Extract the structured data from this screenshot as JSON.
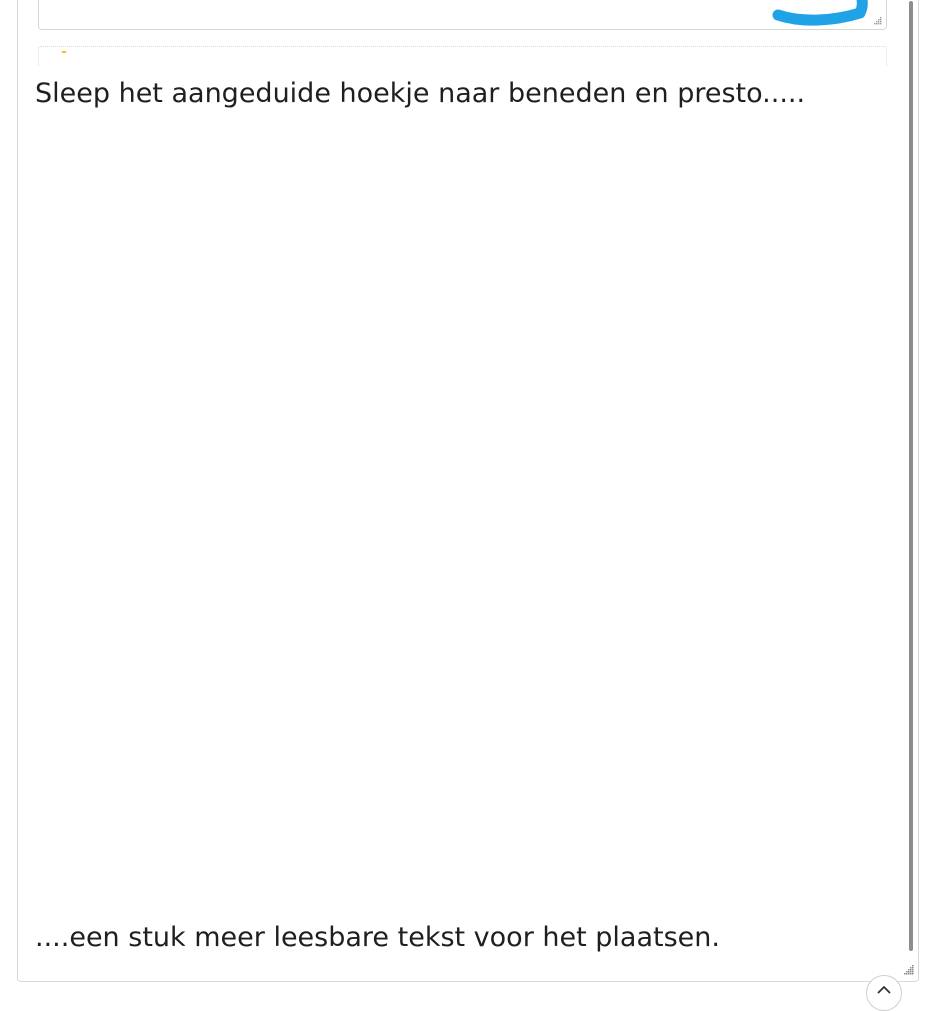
{
  "editor": {
    "line_1": "Sleep het aangeduide hoekje naar beneden en presto.....",
    "line_2": "....een stuk meer leesbare tekst voor het plaatsen."
  },
  "colors": {
    "mark": "#1fa3e6",
    "scrollbar": "#8d8d8d",
    "border": "#d8d8d8"
  },
  "icons": {
    "inner_resize": "resize-grip-icon",
    "outer_resize": "resize-grip-icon",
    "back_to_top": "chevron-up-icon"
  }
}
